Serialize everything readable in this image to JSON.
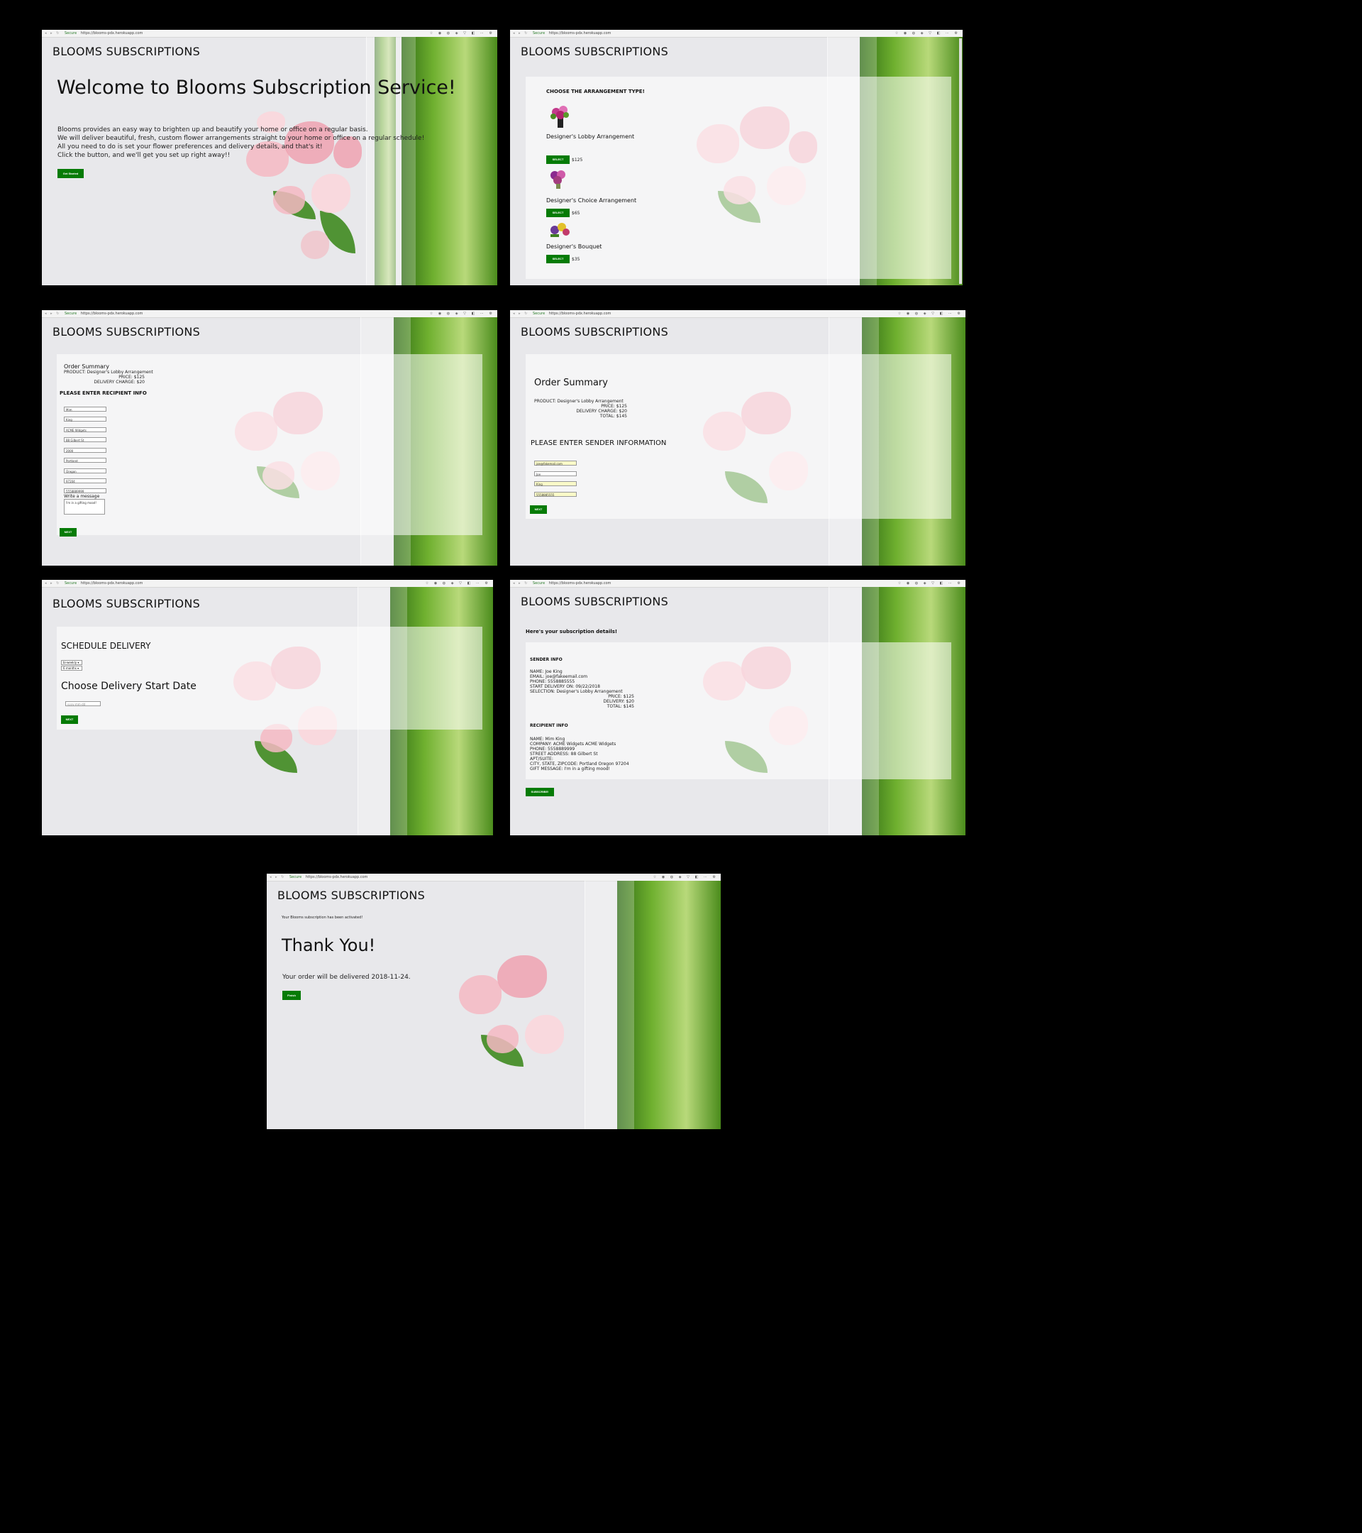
{
  "browser": {
    "secure_label": "Secure",
    "url": "https://blooms-pdx.herokuapp.com"
  },
  "site_title": "BLOOMS SUBSCRIPTIONS",
  "screen1": {
    "heading": "Welcome to Blooms Subscription Service!",
    "lines": [
      "Blooms provides an easy way to brighten up and beautify your home or office on a regular basis.",
      "We will deliver beautiful, fresh, custom flower arrangements straight to your home or office on a regular schedule!",
      "All you need to do is set your flower preferences and delivery details, and that's it!",
      "Click the button, and we'll get you set up right away!!"
    ],
    "button": "Get Started"
  },
  "screen2": {
    "heading": "CHOOSE THE ARRANGEMENT TYPE!",
    "button": "SELECT",
    "items": [
      {
        "name": "Designer's Lobby Arrangement",
        "price": "$125"
      },
      {
        "name": "Designer's Choice Arrangement",
        "price": "$65"
      },
      {
        "name": "Designer's Bouquet",
        "price": "$35"
      }
    ]
  },
  "screen3": {
    "summary_title": "Order Summary",
    "product": "PRODUCT: Designer's Lobby Arrangement",
    "price": "PRICE: $125",
    "delivery": "DELIVERY CHARGE: $20",
    "heading": "PLEASE ENTER RECIPIENT INFO",
    "fields": [
      "Mim",
      "King",
      "ACME Widgets",
      "88 Gilbert St",
      "2000",
      "Portland",
      "Oregon",
      "97204",
      "5558889999"
    ],
    "message_label": "Write a message",
    "message": "I'm in a gifting mood!",
    "button": "NEXT"
  },
  "screen4": {
    "summary_title": "Order Summary",
    "product": "PRODUCT: Designer's Lobby Arrangement",
    "price": "PRICE: $125",
    "delivery": "DELIVERY CHARGE: $20",
    "total": "TOTAL: $145",
    "heading": "PLEASE ENTER SENDER INFORMATION",
    "fields": [
      "joe@fakemail.com",
      "Joe",
      "King",
      "5558885555"
    ],
    "button": "NEXT"
  },
  "screen5": {
    "heading": "SCHEDULE DELIVERY",
    "select1": "bi-weekly",
    "select2": "6 months",
    "date_heading": "Choose Delivery Start Date",
    "date_placeholder": "yyyy-mm-dd",
    "button": "NEXT"
  },
  "screen6": {
    "intro": "Here's your subscription details!",
    "sender_heading": "SENDER INFO",
    "sender_lines": [
      "NAME: Joe King",
      "EMAIL: joe@fakeemail.com",
      "PHONE: 5558885555",
      "START DELIVERY ON: 09/22/2018",
      "SELECTION: Designer's Lobby Arrangement"
    ],
    "price": "PRICE: $125",
    "delivery": "DELIVERY: $20",
    "total": "TOTAL: $145",
    "recipient_heading": "RECIPIENT INFO",
    "recipient_lines": [
      "NAME: Mim King",
      "COMPANY: ACME Widgets ACME Widgets",
      "PHONE: 5558889999",
      "STREET ADDRESS: 88 Gilbert St",
      "APT/SUITE:",
      "CITY, STATE, ZIPCODE: Portland Oregon 97204",
      "GIFT MESSAGE: I'm in a gifting mood!"
    ],
    "button": "SUBSCRIBE!"
  },
  "screen7": {
    "activated": "Your Blooms subscription has been activated!",
    "heading": "Thank You!",
    "delivery_line": "Your order will be delivered 2018-11-24.",
    "button": "Finish"
  }
}
